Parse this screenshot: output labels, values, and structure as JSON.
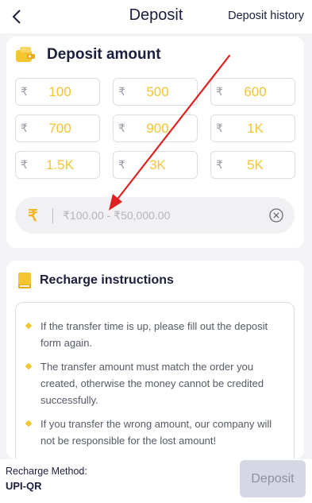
{
  "header": {
    "title": "Deposit",
    "history_link": "Deposit history"
  },
  "deposit_section": {
    "title": "Deposit amount",
    "currency_symbol": "₹",
    "amounts": [
      "100",
      "500",
      "600",
      "700",
      "900",
      "1K",
      "1.5K",
      "3K",
      "5K"
    ],
    "input_placeholder": "₹100.00 - ₹50,000.00"
  },
  "instructions_section": {
    "title": "Recharge instructions",
    "items": [
      "If the transfer time is up, please fill out the deposit form again.",
      "The transfer amount must match the order you created, otherwise the money cannot be credited successfully.",
      "If you transfer the wrong amount, our company will not be responsible for the lost amount!"
    ]
  },
  "footer": {
    "method_label": "Recharge Method:",
    "method_value": "UPI-QR",
    "deposit_button": "Deposit"
  },
  "colors": {
    "accent_yellow": "#f3c531",
    "annotation_arrow": "#e02020",
    "disabled_button": "#d6d7e4"
  },
  "icons": {
    "back": "back-arrow-icon",
    "wallet": "wallet-icon",
    "book": "book-icon",
    "clear": "clear-circle-icon"
  }
}
